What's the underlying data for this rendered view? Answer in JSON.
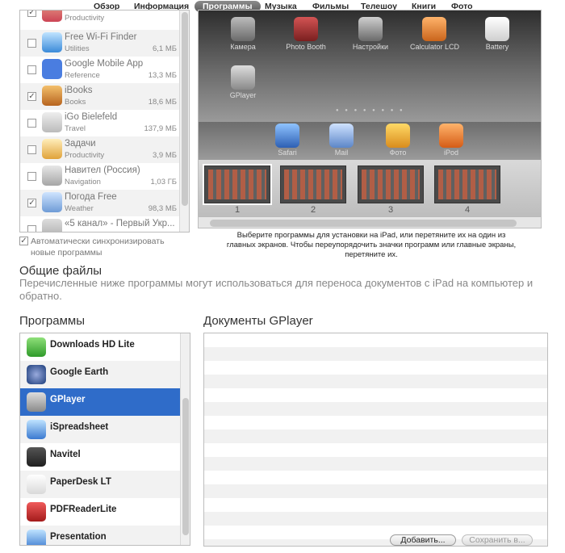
{
  "tabs": [
    "Обзор",
    "Информация",
    "Программы",
    "Музыка",
    "Фильмы",
    "Телешоу",
    "Книги",
    "Фото"
  ],
  "tabs_active": "Программы",
  "app_list": [
    {
      "name": "",
      "category": "Productivity",
      "size": "",
      "checked": true
    },
    {
      "name": "Free Wi-Fi Finder",
      "category": "Utilities",
      "size": "6,1 МБ",
      "checked": false
    },
    {
      "name": "Google Mobile App",
      "category": "Reference",
      "size": "13,3 МБ",
      "checked": false
    },
    {
      "name": "iBooks",
      "category": "Books",
      "size": "18,6 МБ",
      "checked": true
    },
    {
      "name": "iGo Bielefeld",
      "category": "Travel",
      "size": "137,9 МБ",
      "checked": false
    },
    {
      "name": "Задачи",
      "category": "Productivity",
      "size": "3,9 МБ",
      "checked": false
    },
    {
      "name": "Навител (Россия)",
      "category": "Navigation",
      "size": "1,03 ГБ",
      "checked": false
    },
    {
      "name": "Погода Free",
      "category": "Weather",
      "size": "98,3 МБ",
      "checked": true
    },
    {
      "name": "«5 канал» - Первый Укр...",
      "category": "",
      "size": "",
      "checked": false
    }
  ],
  "auto_sync_label": "Автоматически синхронизировать новые программы",
  "home_screen": {
    "icons": [
      "Камера",
      "Photo Booth",
      "Настройки",
      "Calculator LCD",
      "Battery",
      "GPlayer"
    ],
    "dock": [
      "Safari",
      "Mail",
      "Фото",
      "iPod"
    ]
  },
  "page_numbers": [
    "1",
    "2",
    "3",
    "4"
  ],
  "caption": "Выберите программы для установки на iPad, или перетяните их на один из главных экранов. Чтобы переупорядочить значки программ или главные экраны, перетяните их.",
  "shared_files": {
    "title": "Общие файлы",
    "description": "Перечисленные ниже программы могут использоваться для переноса документов с iPad на компьютер и обратно.",
    "apps_header": "Программы",
    "docs_header": "Документы GPlayer",
    "apps": [
      "Downloads HD Lite",
      "Google Earth",
      "GPlayer",
      "iSpreadsheet",
      "Navitel",
      "PaperDesk LT",
      "PDFReaderLite",
      "Presentation"
    ],
    "selected": "GPlayer"
  },
  "buttons": {
    "add": "Добавить...",
    "save": "Сохранить в..."
  }
}
